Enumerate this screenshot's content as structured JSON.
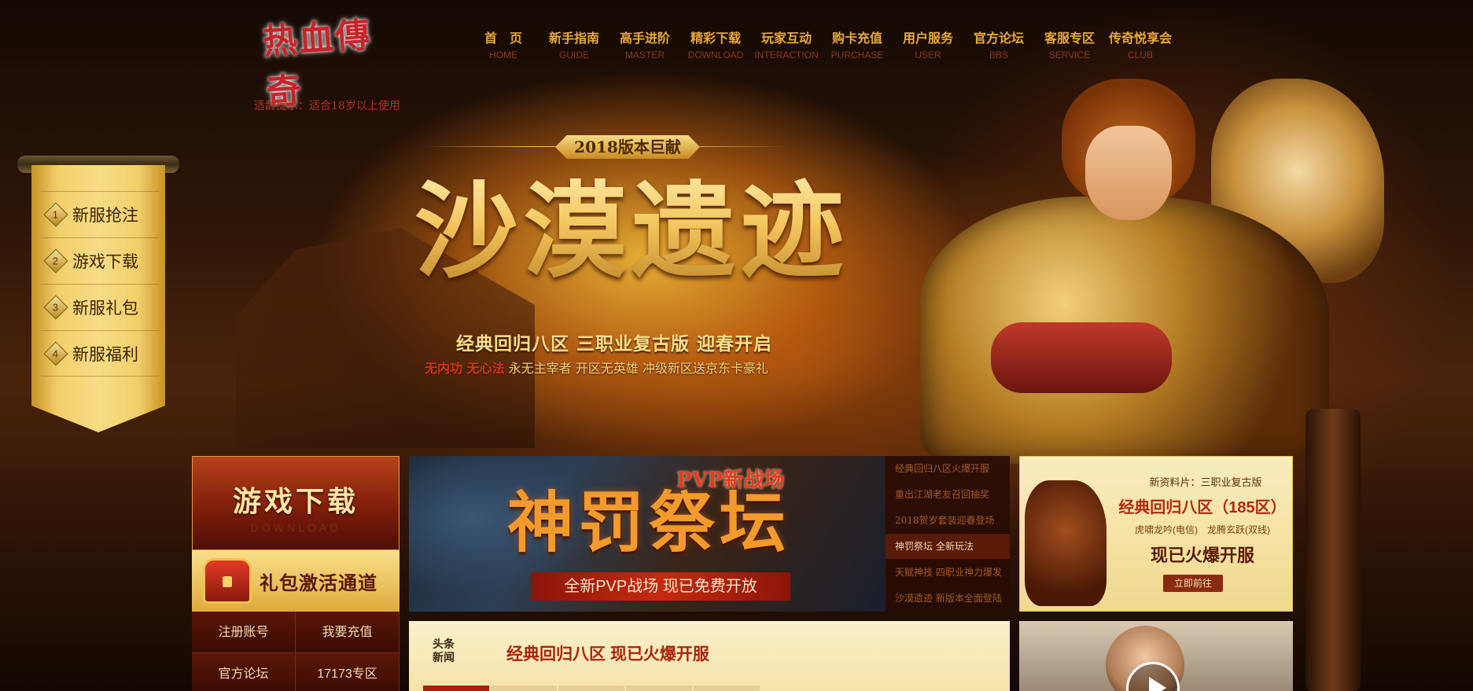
{
  "header": {
    "logo_text": "热血傳奇",
    "age_tip": "适龄提示：适合18岁以上使用",
    "nav": [
      {
        "cn": "首　页",
        "en": "HOME"
      },
      {
        "cn": "新手指南",
        "en": "GUIDE"
      },
      {
        "cn": "高手进阶",
        "en": "MASTER"
      },
      {
        "cn": "精彩下载",
        "en": "DOWNLOAD"
      },
      {
        "cn": "玩家互动",
        "en": "INTERACTION"
      },
      {
        "cn": "购卡充值",
        "en": "PURCHASE"
      },
      {
        "cn": "用户服务",
        "en": "USER"
      },
      {
        "cn": "官方论坛",
        "en": "BBS"
      },
      {
        "cn": "客服专区",
        "en": "SERVICE"
      },
      {
        "cn": "传奇悦享会",
        "en": "CLUB"
      }
    ]
  },
  "scroll_menu": {
    "items": [
      {
        "num": "1",
        "label": "新服抢注"
      },
      {
        "num": "2",
        "label": "游戏下载"
      },
      {
        "num": "3",
        "label": "新服礼包"
      },
      {
        "num": "4",
        "label": "新服福利"
      }
    ]
  },
  "hero": {
    "badge": "2018版本巨献",
    "title": "沙漠遗迹",
    "subtitle": "经典回归八区 三职业复古版 迎春开启",
    "tagline_red": "无内功 无心法",
    "tagline_rest": " 永无主宰者 开区无英雄 冲级新区送京东卡豪礼"
  },
  "left_column": {
    "download_title": "游戏下载",
    "download_sub": "DOWNLOAD",
    "gift_title": "礼包激活通道",
    "links": [
      "注册账号",
      "我要充值",
      "官方论坛",
      "17173专区"
    ]
  },
  "banner": {
    "pvp_tag": "PVP新战场",
    "title": "神罚祭坛",
    "strip": "全新PVP战场  现已免费开放"
  },
  "news_list": {
    "items": [
      {
        "text": "经典回归八区火爆开服",
        "active": false
      },
      {
        "text": "重出江湖老友召回抽奖",
        "active": false
      },
      {
        "text": "2018贺岁套装迎春登场",
        "active": false
      },
      {
        "text": "神罚祭坛 全新玩法",
        "active": true
      },
      {
        "text": "天赋神技 四职业神力爆发",
        "active": false
      },
      {
        "text": "沙漠遗迹 新版本全面登陆",
        "active": false
      }
    ]
  },
  "promo": {
    "line1": "新资料片：三职业复古版",
    "line2": "经典回归八区（185区）",
    "line3": "虎啸龙吟(电信)　龙腾玄跃(双线)",
    "line4": "现已火爆开服",
    "button": "立即前往"
  },
  "headline": {
    "tag": "头条新闻",
    "title": "经典回归八区 现已火爆开服"
  },
  "colors": {
    "accent_gold": "#f4c65e",
    "accent_red": "#a8260c",
    "nav_text": "#e8aa3a"
  }
}
